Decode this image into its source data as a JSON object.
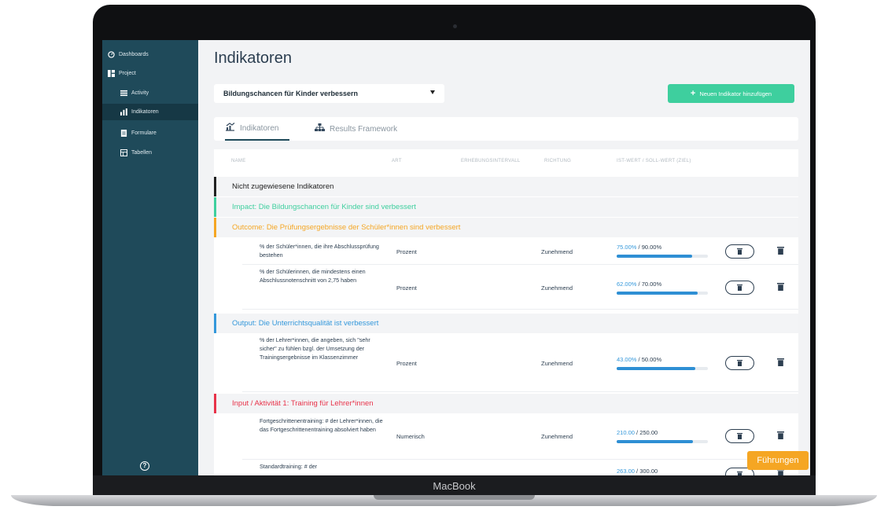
{
  "device": {
    "brand": "MacBook"
  },
  "sidebar": {
    "items": [
      {
        "label": "Dashboards",
        "icon": "dashboard-icon"
      },
      {
        "label": "Project",
        "icon": "project-icon"
      },
      {
        "label": "Activity",
        "icon": "list-icon"
      },
      {
        "label": "Indikatoren",
        "icon": "bar-chart-icon"
      },
      {
        "label": "Formulare",
        "icon": "document-icon"
      },
      {
        "label": "Tabellen",
        "icon": "table-icon"
      }
    ],
    "active_item": "Indikatoren",
    "help_icon": "question-icon"
  },
  "page": {
    "title": "Indikatoren",
    "select": {
      "value": "Bildungschancen für Kinder verbessern"
    },
    "add_button": {
      "label": "Neuen Indikator hinzufügen"
    },
    "tabs": [
      {
        "label": "Indikatoren",
        "icon": "chart-icon",
        "active": true
      },
      {
        "label": "Results Framework",
        "icon": "hierarchy-icon",
        "active": false
      }
    ],
    "table": {
      "headers": {
        "name": "NAME",
        "art": "ART",
        "interval": "ERHEBUNGSINTERVALL",
        "richtung": "RICHTUNG",
        "werte": "IST-WERT / SOLL-WERT (ZIEL)"
      },
      "groups": {
        "unassigned": {
          "label": "Nicht zugewiesene Indikatoren",
          "color": "#222222"
        },
        "impact": {
          "label": "Impact: Die Bildungschancen für Kinder sind verbessert",
          "color": "#3ecf9e"
        },
        "outcome": {
          "label": "Outcome: Die Prüfungsergebnisse der Schüler*innen sind verbessert",
          "color": "#f5a623"
        },
        "output": {
          "label": "Output: Die Unterrichtsqualität ist verbessert",
          "color": "#3498db"
        },
        "input": {
          "label": "Input / Aktivität 1: Training für Lehrer*innen",
          "color": "#e8334a"
        }
      },
      "rows": [
        {
          "name": "% der Schüler*innen, die ihre Abschlussprüfung bestehen",
          "art": "Prozent",
          "richtung": "Zunehmend",
          "ist": "75.00%",
          "soll": "90.00%",
          "progress": 0.83
        },
        {
          "name": "% der Schülerinnen, die mindestens einen Abschlussnotenschnitt von 2,75 haben",
          "art": "Prozent",
          "richtung": "Zunehmend",
          "ist": "62.00%",
          "soll": "70.00%",
          "progress": 0.89
        },
        {
          "name": "% der Lehrer*innen, die angeben, sich \"sehr sicher\" zu fühlen bzgl. der Umsetzung der Trainingsergebnisse im Klassenzimmer",
          "art": "Prozent",
          "richtung": "Zunehmend",
          "ist": "43.00%",
          "soll": "50.00%",
          "progress": 0.86
        },
        {
          "name": "Fortgeschrittenentraining: # der Lehrer*innen, die das Fortgeschrittenentraining absolviert haben",
          "art": "Numerisch",
          "richtung": "Zunehmend",
          "ist": "210.00",
          "soll": "250.00",
          "progress": 0.84
        },
        {
          "name": "Standardtraining: # der",
          "art": "",
          "richtung": "",
          "ist": "263.00",
          "soll": "300.00",
          "progress": 0.88
        }
      ]
    },
    "tour_button": {
      "label": "Führungen"
    }
  }
}
